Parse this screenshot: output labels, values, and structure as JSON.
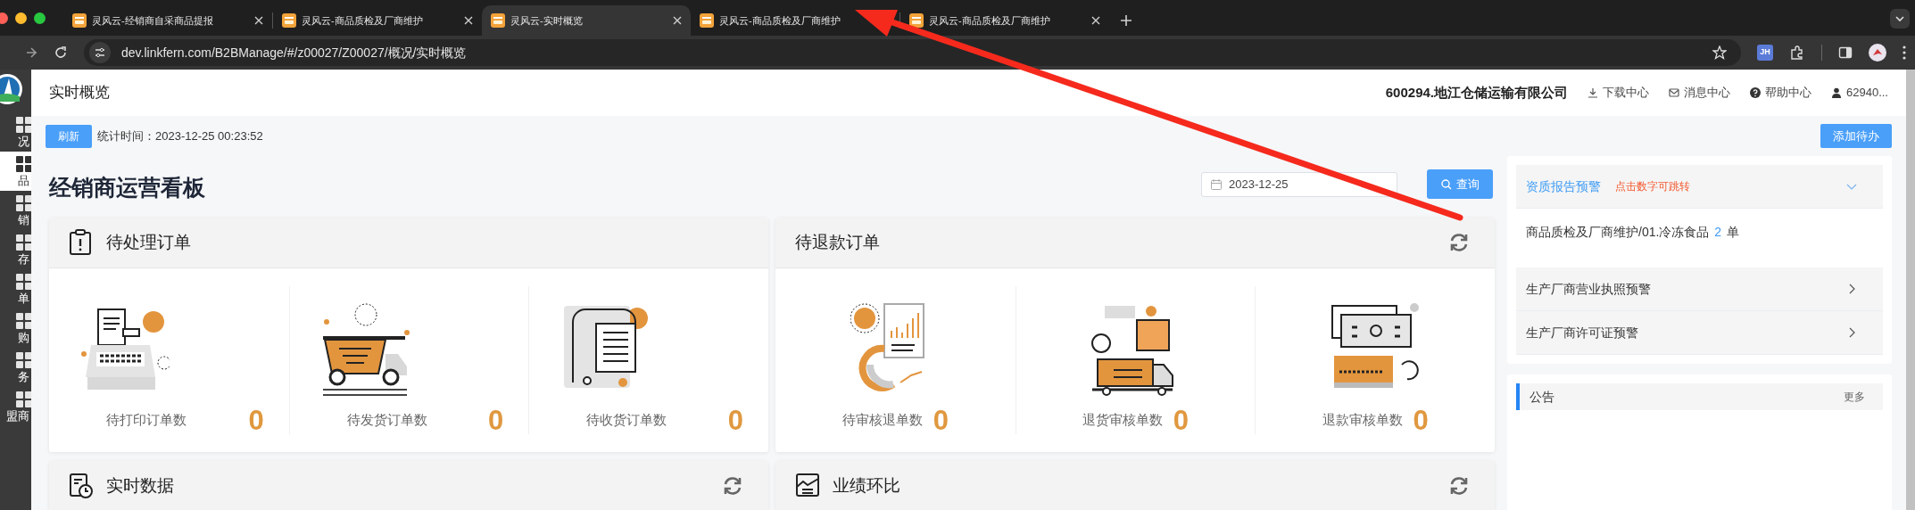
{
  "browser": {
    "tabs": [
      {
        "title": "灵风云-经销商自采商品提报",
        "selected": false
      },
      {
        "title": "灵风云-商品质检及厂商维护",
        "selected": false
      },
      {
        "title": "灵风云-实时概览",
        "selected": true
      },
      {
        "title": "灵风云-商品质检及厂商维护",
        "selected": false
      },
      {
        "title": "灵风云-商品质检及厂商维护",
        "selected": false
      }
    ],
    "url": "dev.linkfern.com/B2BManage/#/z00027/Z00027/概况/实时概览",
    "profile_badge": "JH"
  },
  "sidebar": {
    "items": [
      {
        "label": "况",
        "selected": false
      },
      {
        "label": "品",
        "selected": true
      },
      {
        "label": "销",
        "selected": false
      },
      {
        "label": "存",
        "selected": false
      },
      {
        "label": "单",
        "selected": false
      },
      {
        "label": "购",
        "selected": false
      },
      {
        "label": "务",
        "selected": false
      },
      {
        "label": "盟商",
        "selected": false
      }
    ]
  },
  "header": {
    "title": "实时概览",
    "company": "600294.地江仓储运输有限公司",
    "links": [
      {
        "kind": "download",
        "label": "下载中心"
      },
      {
        "kind": "message",
        "label": "消息中心"
      },
      {
        "kind": "help",
        "label": "帮助中心"
      },
      {
        "kind": "user",
        "label": "62940..."
      }
    ]
  },
  "toolbar": {
    "refresh_button": "刷新",
    "stat_time": "统计时间：2023-12-25 00:23:52",
    "add_todo_button": "添加待办"
  },
  "board": {
    "title": "经销商运营看板",
    "date": "2023-12-25",
    "query_button": "查询",
    "cards": [
      {
        "title": "待处理订单",
        "refresh": false,
        "kind": "spread",
        "metrics": [
          {
            "kind": "printer",
            "label": "待打印订单数",
            "value": "0"
          },
          {
            "kind": "truck",
            "label": "待发货订单数",
            "value": "0"
          },
          {
            "kind": "receipt",
            "label": "待收货订单数",
            "value": "0"
          }
        ]
      },
      {
        "title": "待退款订单",
        "refresh": true,
        "kind": "compact",
        "metrics": [
          {
            "kind": "report",
            "label": "待审核退单数",
            "value": "0"
          },
          {
            "kind": "delivery",
            "label": "退货审核单数",
            "value": "0"
          },
          {
            "kind": "cash",
            "label": "退款审核单数",
            "value": "0"
          }
        ]
      },
      {
        "title": "实时数据",
        "refresh": true
      },
      {
        "title": "业绩环比",
        "refresh": true
      }
    ]
  },
  "alerts": {
    "sections": [
      {
        "title": "资质报告预警",
        "hint": "点击数字可跳转",
        "expanded": true,
        "entries": [
          {
            "text": "商品质检及厂商维护/01.冷冻食品",
            "count": "2",
            "unit": "单"
          }
        ]
      },
      {
        "title": "生产厂商营业执照预警",
        "expanded": false
      },
      {
        "title": "生产厂商许可证预警",
        "expanded": false
      }
    ]
  },
  "notice": {
    "title": "公告",
    "more": "更多"
  }
}
